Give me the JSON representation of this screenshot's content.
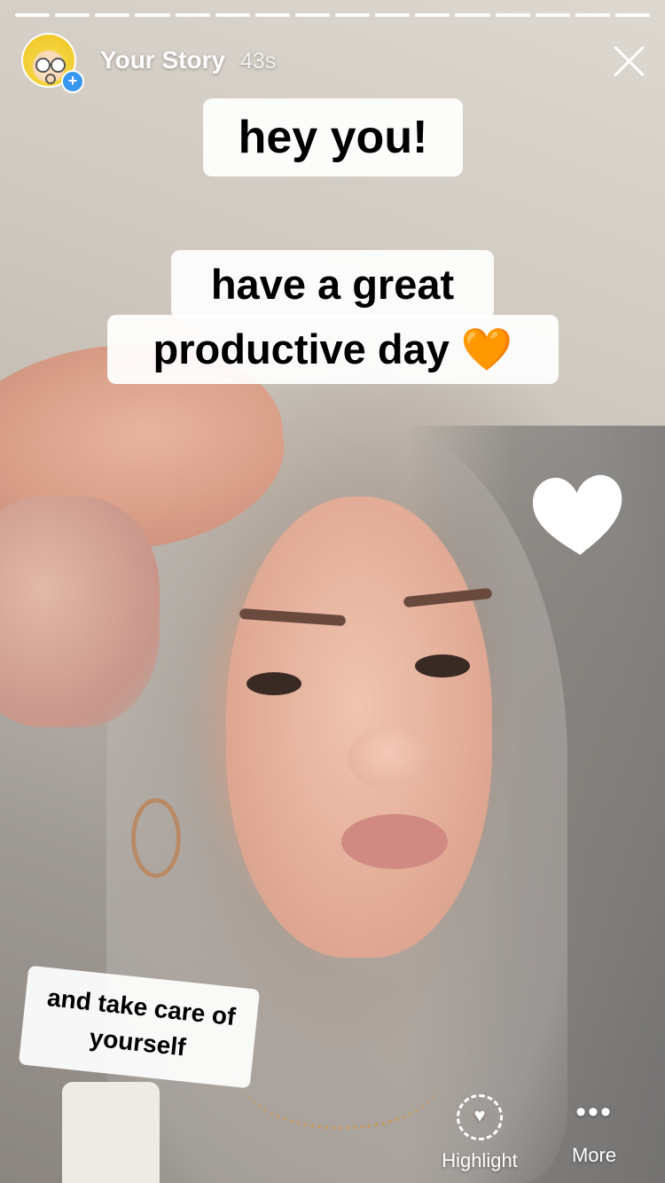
{
  "story": {
    "title": "Your Story",
    "time": "43s",
    "progress_segments_total": 16,
    "progress_segments_done": 16
  },
  "stickers": {
    "line1": "hey you!",
    "line2a": "have a great",
    "line2b": "productive day",
    "line2_emoji": "🧡",
    "line3": "and take care of yourself"
  },
  "actions": {
    "highlight_label": "Highlight",
    "more_label": "More"
  },
  "icons": {
    "close": "close-icon",
    "highlight": "heart-circle-icon",
    "more": "more-dots-icon",
    "add": "plus-icon"
  },
  "colors": {
    "accent_blue": "#3897f0",
    "emoji_orange": "#f3931f"
  }
}
